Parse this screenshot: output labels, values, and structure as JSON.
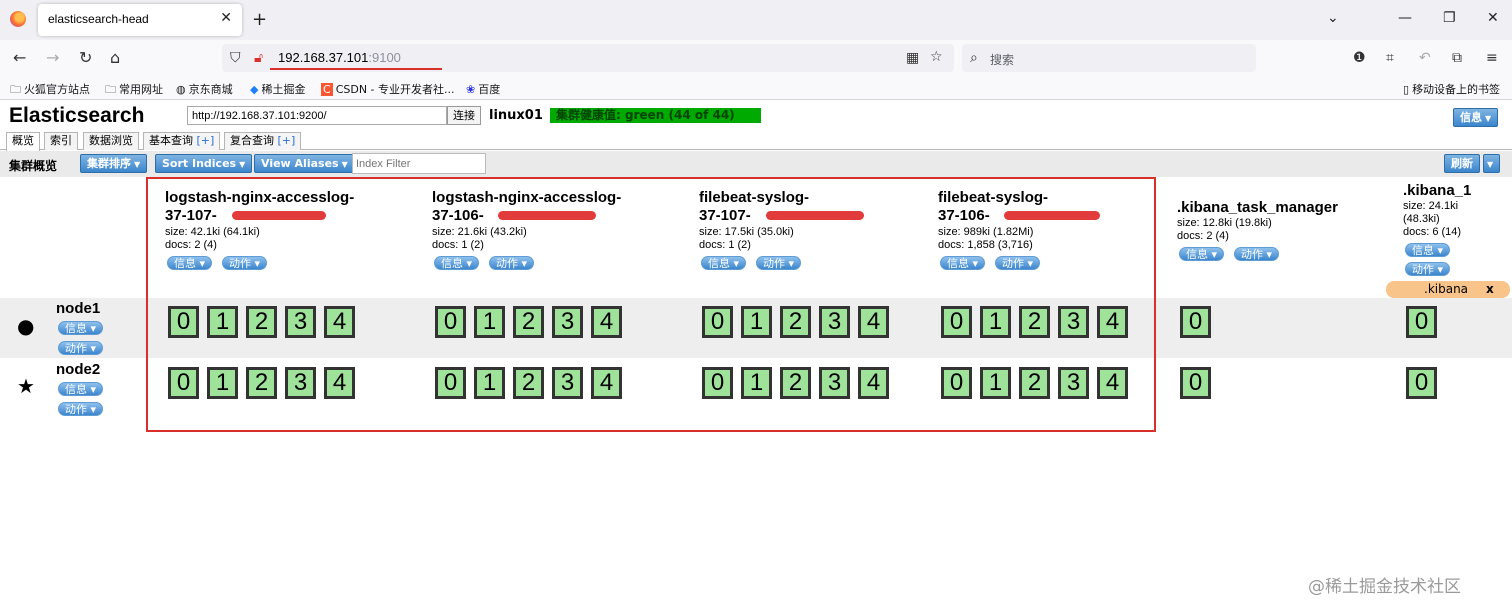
{
  "browser": {
    "tab_title": "elasticsearch-head",
    "url_host": "192.168.37.101",
    "url_port": ":9100",
    "search_placeholder": "搜索",
    "bookmarks": [
      "火狐官方站点",
      "常用网址",
      "京东商城",
      "稀土掘金",
      "CSDN - 专业开发者社...",
      "百度"
    ],
    "mobile_bookmarks": "移动设备上的书签"
  },
  "es": {
    "title": "Elasticsearch",
    "url_value": "http://192.168.37.101:9200/",
    "connect": "连接",
    "cluster_name": "linux01",
    "health": "集群健康值: green (44 of 44)",
    "info_menu": "信息",
    "tabs": [
      {
        "label": "概览",
        "plus": ""
      },
      {
        "label": "索引",
        "plus": ""
      },
      {
        "label": "数据浏览",
        "plus": ""
      },
      {
        "label": "基本查询 ",
        "plus": "[+]"
      },
      {
        "label": "复合查询 ",
        "plus": "[+]"
      }
    ],
    "toolbar": {
      "label": "集群概览",
      "sort_cluster": "集群排序",
      "sort_indices": "Sort Indices",
      "view_aliases": "View Aliases",
      "filter_placeholder": "Index Filter",
      "refresh": "刷新"
    }
  },
  "labels": {
    "info": "信息",
    "action": "动作"
  },
  "indices": [
    {
      "line1": "logstash-nginx-accesslog-",
      "line2": "37-107-",
      "size": "size: 42.1ki (64.1ki)",
      "docs": "docs: 2 (4)",
      "shards": [
        "0",
        "1",
        "2",
        "3",
        "4"
      ]
    },
    {
      "line1": "logstash-nginx-accesslog-",
      "line2": "37-106-",
      "size": "size: 21.6ki (43.2ki)",
      "docs": "docs: 1 (2)",
      "shards": [
        "0",
        "1",
        "2",
        "3",
        "4"
      ]
    },
    {
      "line1": "filebeat-syslog-",
      "line2": "37-107-",
      "size": "size: 17.5ki (35.0ki)",
      "docs": "docs: 1 (2)",
      "shards": [
        "0",
        "1",
        "2",
        "3",
        "4"
      ]
    },
    {
      "line1": "filebeat-syslog-",
      "line2": "37-106-",
      "size": "size: 989ki (1.82Mi)",
      "docs": "docs: 1,858 (3,716)",
      "shards": [
        "0",
        "1",
        "2",
        "3",
        "4"
      ]
    },
    {
      "line1": ".kibana_task_manager",
      "line2": "",
      "size": "size: 12.8ki (19.8ki)",
      "docs": "docs: 2 (4)",
      "shards": [
        "0"
      ]
    },
    {
      "line1": ".kibana_1",
      "line2": "",
      "size": "size: 24.1ki",
      "size2": "(48.3ki)",
      "docs": "docs: 6 (14)",
      "shards": [
        "0"
      ]
    }
  ],
  "alias": {
    "name": ".kibana",
    "close": "x"
  },
  "nodes": [
    {
      "name": "node1",
      "icon": "circle-icon"
    },
    {
      "name": "node2",
      "icon": "star-icon"
    }
  ],
  "watermark": "@稀土掘金技术社区"
}
